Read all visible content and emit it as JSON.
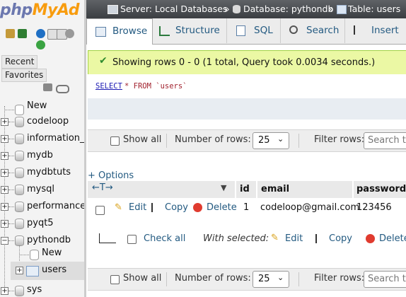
{
  "logo": {
    "part1": "php",
    "part2": "MyAd"
  },
  "nav": {
    "recent": "Recent",
    "favorites": "Favorites",
    "tree": [
      {
        "label": "New"
      },
      {
        "label": "codeloop"
      },
      {
        "label": "information_s"
      },
      {
        "label": "mydb"
      },
      {
        "label": "mydbtuts"
      },
      {
        "label": "mysql"
      },
      {
        "label": "performance_"
      },
      {
        "label": "pyqt5"
      },
      {
        "label": "pythondb"
      },
      {
        "label": "New"
      },
      {
        "label": "users"
      },
      {
        "label": "sys"
      }
    ]
  },
  "breadcrumb": {
    "server": "Server: Local Databases",
    "sep": "»",
    "database": "Database: pythondb",
    "table": "Table: users"
  },
  "tabs": [
    {
      "label": "Browse",
      "icon": "browse-icon"
    },
    {
      "label": "Structure",
      "icon": "structure-icon"
    },
    {
      "label": "SQL",
      "icon": "sql-icon"
    },
    {
      "label": "Search",
      "icon": "search-icon"
    },
    {
      "label": "Insert",
      "icon": "insert-icon"
    }
  ],
  "message": "Showing rows 0 - 0 (1 total, Query took 0.0034 seconds.)",
  "sql": {
    "keyword1": "SELECT",
    "rest": "* FROM `users`"
  },
  "controls": {
    "show_all": "Show all",
    "number_of_rows": "Number of rows:",
    "rows_value": "25",
    "filter_rows": "Filter rows:",
    "search_placeholder": "Search th"
  },
  "options_link": "+ Options",
  "table": {
    "headers": [
      "id",
      "email",
      "password"
    ],
    "row": {
      "edit": "Edit",
      "copy": "Copy",
      "delete": "Delete",
      "id": "1",
      "email": "codeloop@gmail.com",
      "password": "123456"
    }
  },
  "bulk": {
    "check_all": "Check all",
    "with_selected": "With selected:",
    "edit": "Edit",
    "copy": "Copy",
    "delete": "Delete"
  },
  "colors": {
    "link": "#235a81",
    "success_bg": "#ebf8a4",
    "breadcrumb_bg": "#4a4d51"
  }
}
